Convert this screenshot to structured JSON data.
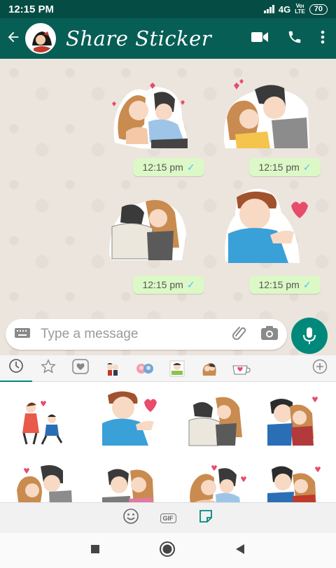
{
  "status_bar": {
    "time": "12:15 PM",
    "network": "4G",
    "volte_top": "Voı",
    "volte_bottom": "LTE",
    "battery": "70"
  },
  "app_bar": {
    "title": "Share Sticker",
    "icons": [
      "back-arrow-icon",
      "video-call-icon",
      "phone-icon",
      "more-vert-icon"
    ]
  },
  "messages": [
    {
      "time": "12:15 pm",
      "status": "✓"
    },
    {
      "time": "12:15 pm",
      "status": "✓"
    },
    {
      "time": "12:15 pm",
      "status": "✓"
    },
    {
      "time": "12:15 pm",
      "status": "✓"
    }
  ],
  "composer": {
    "placeholder": "Type a message"
  },
  "sticker_tray": {
    "tabs": [
      "recent-icon",
      "star-icon",
      "heart-icon",
      "pack-1",
      "pack-2",
      "pack-3",
      "pack-4",
      "pack-5",
      "add-icon"
    ],
    "gif_label": "GIF"
  },
  "colors": {
    "header": "#075e54",
    "status": "#054d44",
    "accent": "#00897b",
    "bubble": "#dcf8c6",
    "chat_bg": "#ece5dd"
  }
}
